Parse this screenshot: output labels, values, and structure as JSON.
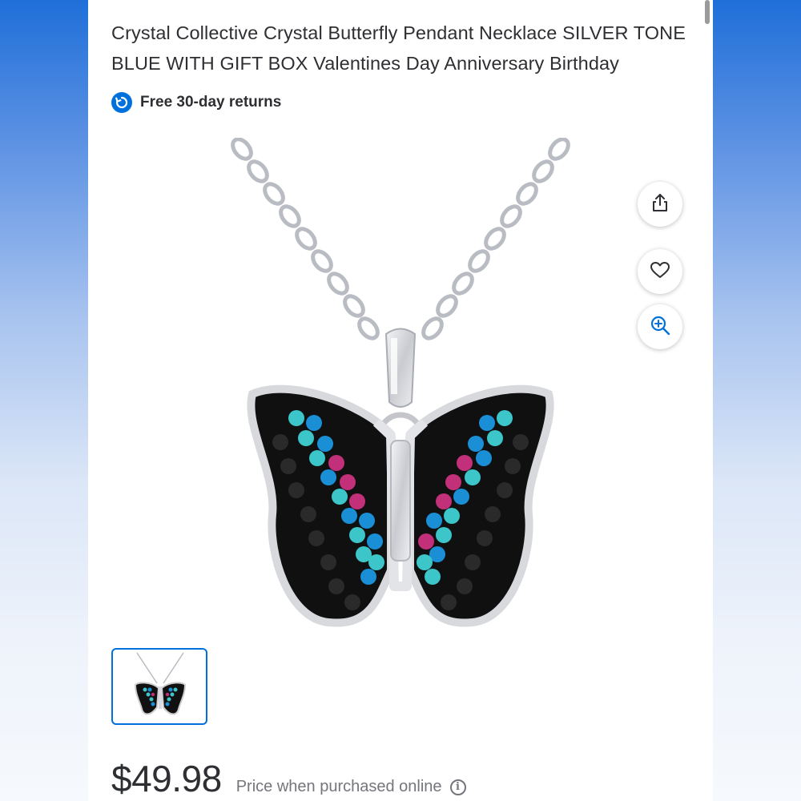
{
  "product": {
    "title": "Crystal Collective Crystal Butterfly Pendant Necklace SILVER TONE BLUE WITH GIFT BOX Valentines Day Anniversary Birthday",
    "returns_label": "Free 30-day returns",
    "price": "$49.98",
    "price_note": "Price when purchased online"
  },
  "actions": {
    "share_icon": "share-icon",
    "favorite_icon": "heart-icon",
    "zoom_icon": "zoom-in-icon"
  },
  "colors": {
    "accent": "#0071dc",
    "text": "#2e2f32",
    "muted": "#74767c",
    "crystal_teal": "#3cc6c9",
    "crystal_blue": "#1a8fd6",
    "crystal_pink": "#c2307a",
    "crystal_black": "#141414"
  }
}
